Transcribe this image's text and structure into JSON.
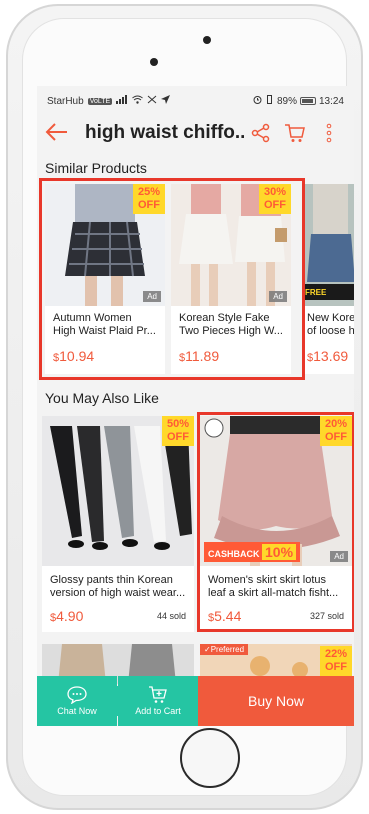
{
  "status_bar": {
    "carrier": "StarHub",
    "carrier_badge": "VoLTE",
    "icons_left": [
      "signal-icon",
      "wifi-icon",
      "data-icon",
      "location-icon"
    ],
    "battery": "89%",
    "time": "13:24"
  },
  "header": {
    "title": "high waist chiffo...",
    "icons": [
      "back-arrow-icon",
      "share-icon",
      "cart-icon",
      "more-icon"
    ]
  },
  "similar": {
    "title": "Similar Products",
    "items": [
      {
        "discount": "25%\nOFF",
        "ad": "Ad",
        "name": "Autumn Women High Waist Plaid Pr...",
        "currency": "$",
        "price": "10.94"
      },
      {
        "discount": "30%\nOFF",
        "ad": "Ad",
        "name": "Korean Style Fake Two Pieces High W...",
        "currency": "$",
        "price": "11.89"
      },
      {
        "badge": "FREE",
        "name": "New Korea of loose hi",
        "currency": "$",
        "price": "13.69"
      }
    ]
  },
  "ymal": {
    "title": "You May Also Like",
    "items": [
      {
        "discount": "50%\nOFF",
        "name": "Glossy pants thin Korean version of high waist wear...",
        "currency": "$",
        "price": "4.90",
        "sold": "44 sold"
      },
      {
        "discount": "20%\nOFF",
        "ad": "Ad",
        "cashback_label": "CASHBACK",
        "cashback_pct": "10%",
        "name": "Women's skirt skirt lotus leaf a skirt all-match fisht...",
        "currency": "$",
        "price": "5.44",
        "sold": "327 sold"
      }
    ],
    "preferred_label": "Preferred",
    "peek_discount": "22%\nOFF"
  },
  "bottom_bar": {
    "chat_label": "Chat Now",
    "cart_label": "Add to Cart",
    "buy_label": "Buy Now"
  },
  "colors": {
    "accent": "#f05a3c",
    "teal": "#25c5a3",
    "highlight": "#e8372a",
    "discount_bg": "#ffd82a"
  }
}
